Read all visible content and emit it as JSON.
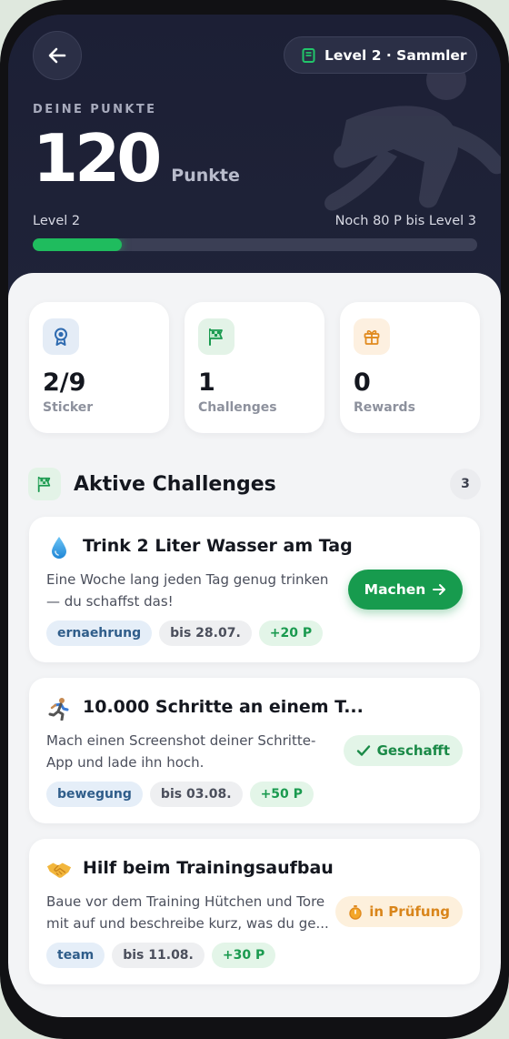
{
  "header": {
    "level_badge": "Level 2 · Sammler",
    "eyebrow": "DEINE PUNKTE",
    "points": "120",
    "points_unit": "Punkte",
    "level_label": "Level 2",
    "next_level_text": "Noch 80 P bis Level 3",
    "progress": 0.2
  },
  "stats": [
    {
      "value": "2/9",
      "label": "Sticker",
      "icon": "award-icon"
    },
    {
      "value": "1",
      "label": "Challenges",
      "icon": "flag-icon"
    },
    {
      "value": "0",
      "label": "Rewards",
      "icon": "gift-icon"
    }
  ],
  "section": {
    "title": "Aktive Challenges",
    "count": "3"
  },
  "challenges": [
    {
      "icon": "water-drop-icon",
      "title": "Trink 2 Liter Wasser am Tag",
      "description": "Eine Woche lang jeden Tag genug trinken — du schaffst das!",
      "tags": [
        "ernaehrung",
        "bis 28.07.",
        "+20 P"
      ],
      "action": "Machen"
    },
    {
      "icon": "runner-icon",
      "title": "10.000 Schritte an einem T...",
      "description": "Mach einen Screenshot deiner Schritte-App und lade ihn hoch.",
      "tags": [
        "bewegung",
        "bis 03.08.",
        "+50 P"
      ],
      "status": "Geschafft"
    },
    {
      "icon": "handshake-icon",
      "title": "Hilf beim Trainingsaufbau",
      "description": "Baue vor dem Training Hütchen und Tore mit auf und beschreibe kurz, was du ge...",
      "tags": [
        "team",
        "bis 11.08.",
        "+30 P"
      ],
      "status": "in Prüfung"
    }
  ],
  "colors": {
    "hero_bg": "#1c1f35",
    "accent_green": "#179b4e",
    "sheet_bg": "#f3f4f6",
    "review_orange": "#d9851a"
  }
}
